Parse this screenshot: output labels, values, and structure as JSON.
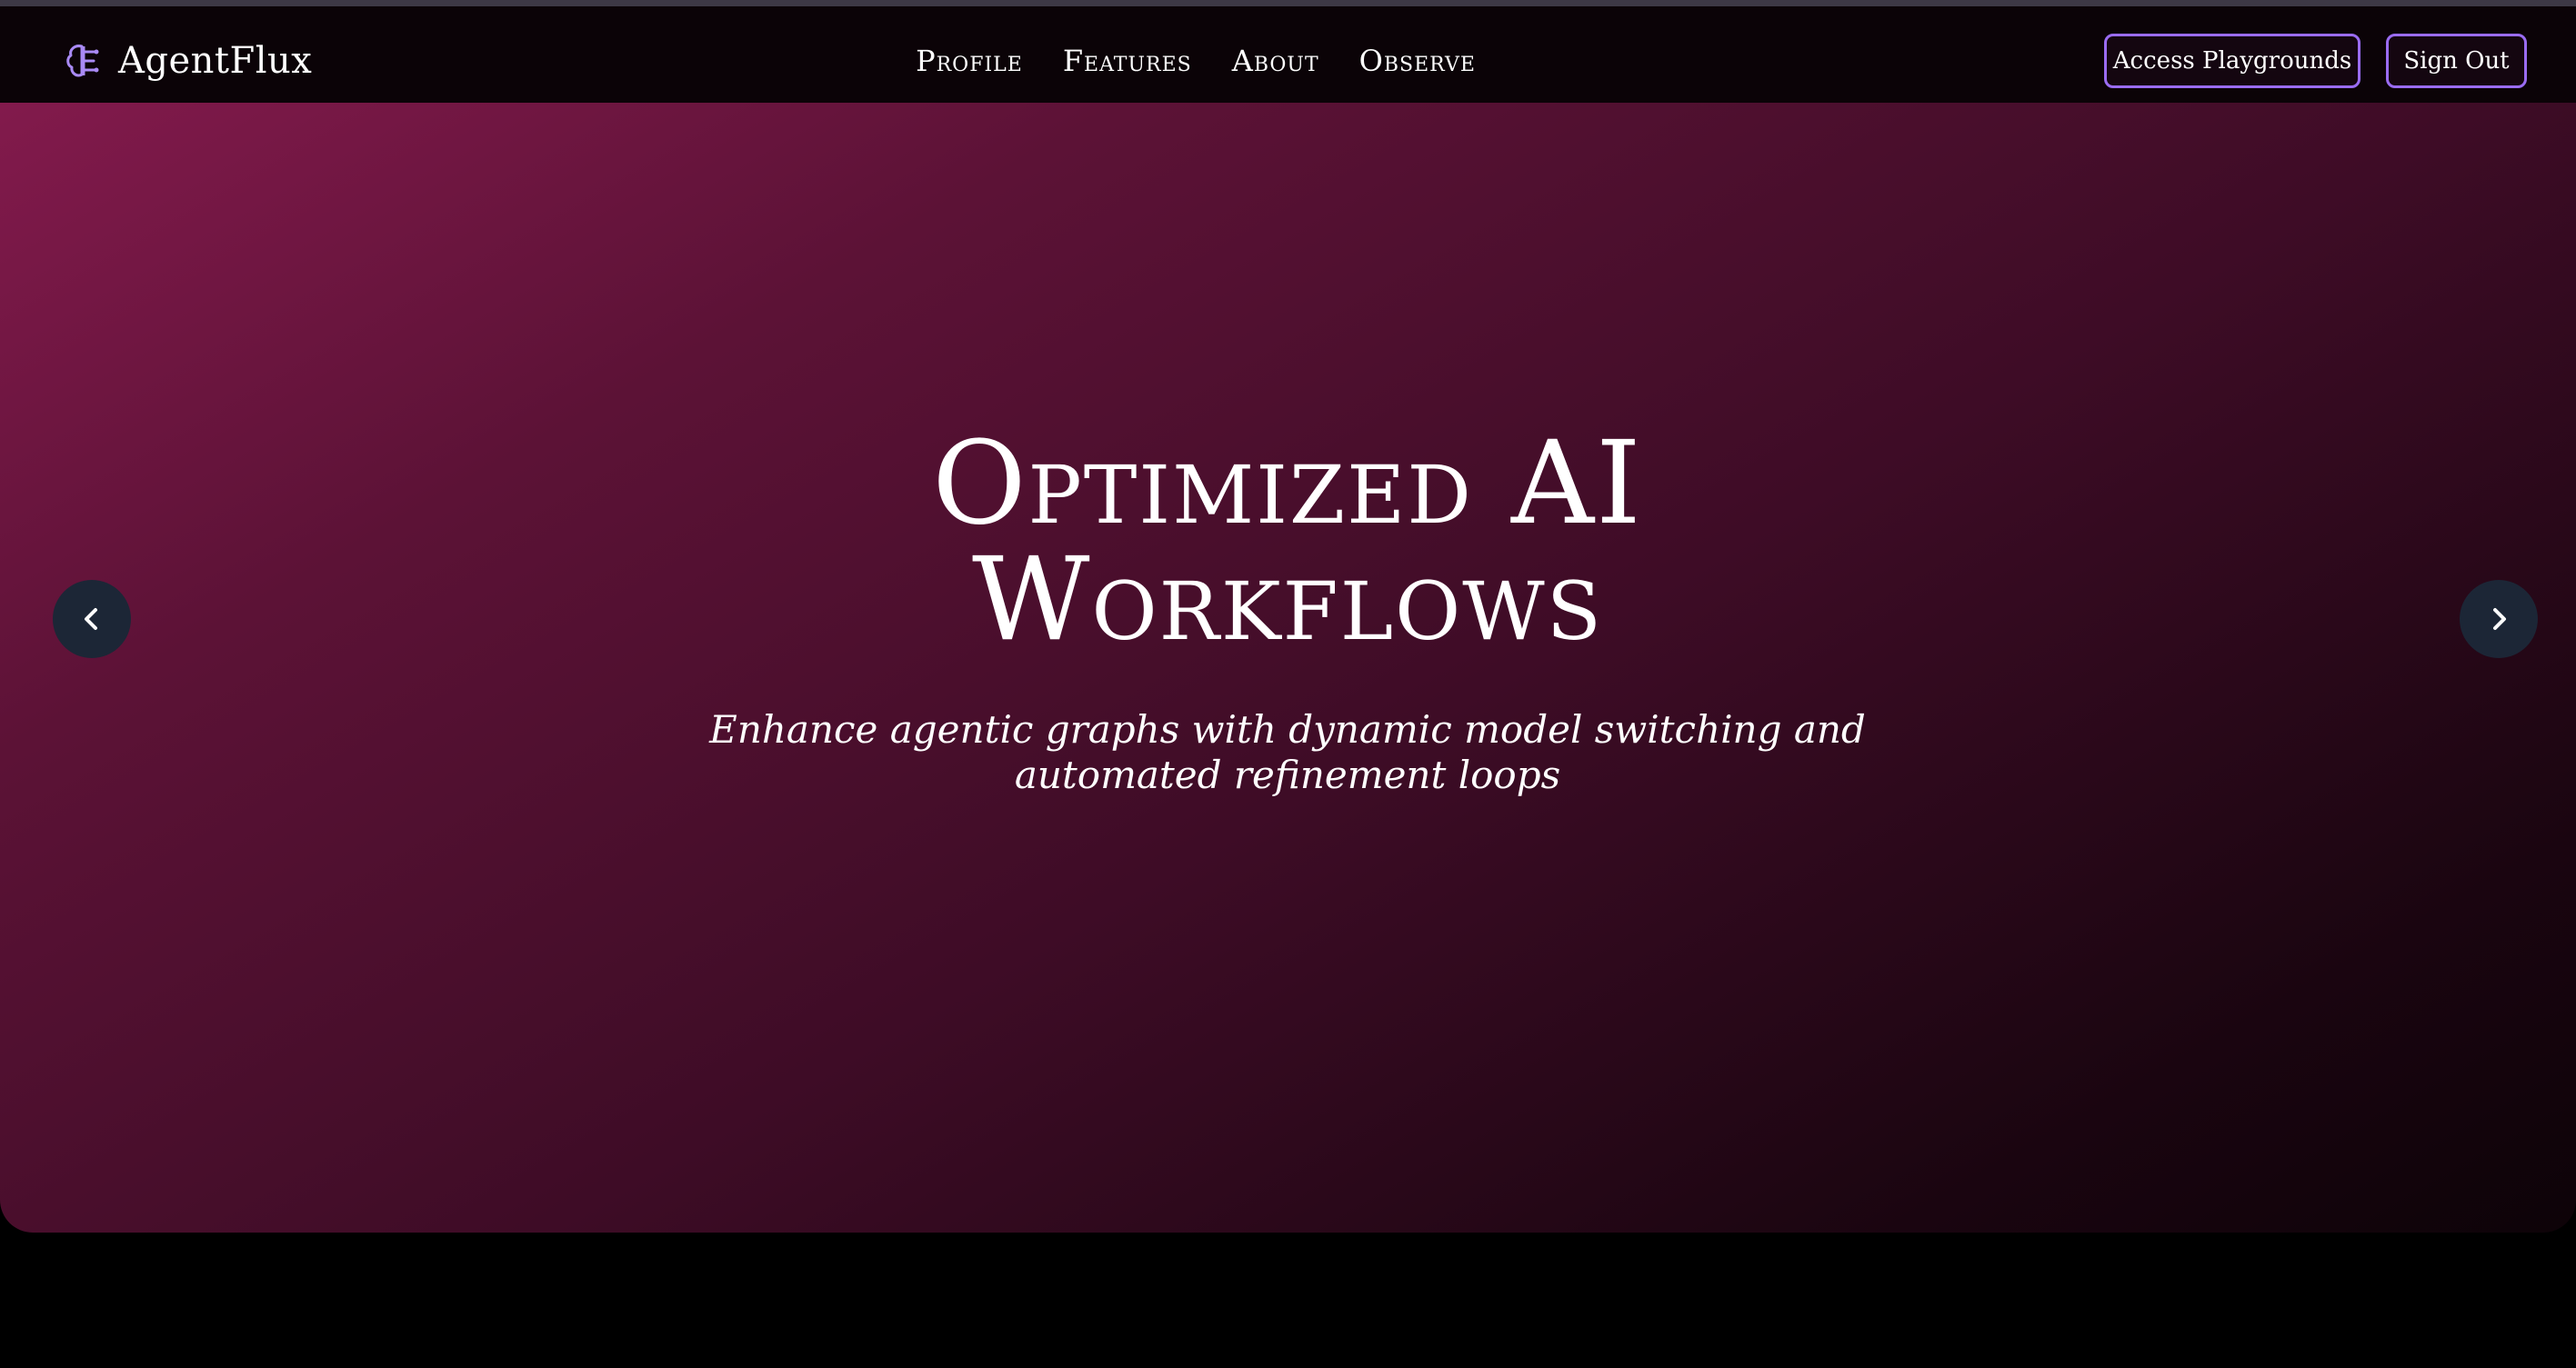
{
  "brand": {
    "name": "AgentFlux",
    "icon": "brain-icon"
  },
  "nav": {
    "links": [
      "Profile",
      "Features",
      "About",
      "Observe"
    ]
  },
  "actions": {
    "playgrounds_label": "Access Playgrounds",
    "signout_label": "Sign Out"
  },
  "hero": {
    "title_line1": "Optimized AI",
    "title_line2": "Workflows",
    "subtitle": "Enhance agentic graphs with dynamic model switching and automated refinement loops"
  },
  "carousel": {
    "prev_icon": "chevron-left-icon",
    "next_icon": "chevron-right-icon"
  },
  "colors": {
    "accent": "#9a6cf2",
    "hero_start": "#821a4c",
    "hero_end": "#0d0308",
    "nav_bg": "#0b0307",
    "carousel_button": "#1c2636"
  }
}
